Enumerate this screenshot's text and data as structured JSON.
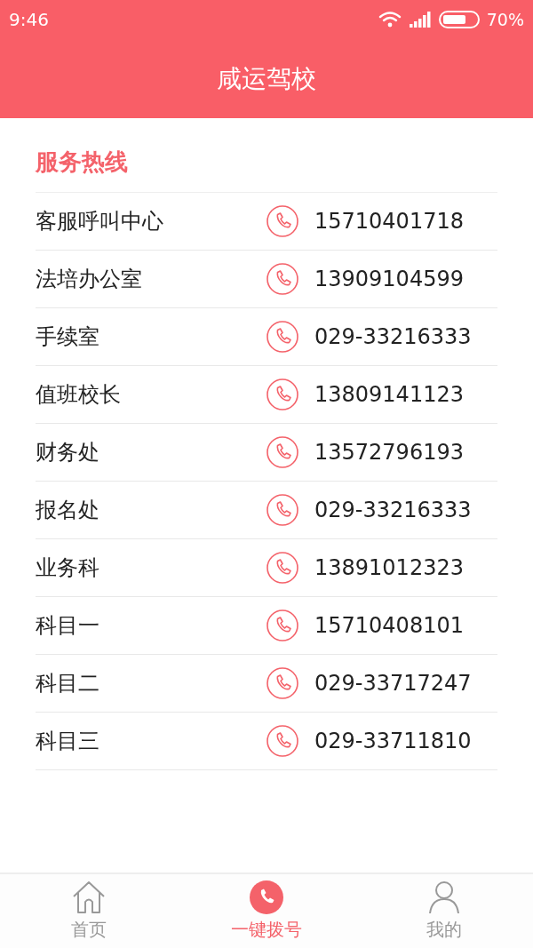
{
  "status_bar": {
    "time": "9:46",
    "battery_text": "70%"
  },
  "header": {
    "title": "咸运驾校"
  },
  "section": {
    "title": "服务热线"
  },
  "contacts": [
    {
      "name": "客服呼叫中心",
      "phone": "15710401718"
    },
    {
      "name": "法培办公室",
      "phone": "13909104599"
    },
    {
      "name": "手续室",
      "phone": "029-33216333"
    },
    {
      "name": "值班校长",
      "phone": "13809141123"
    },
    {
      "name": "财务处",
      "phone": "13572796193"
    },
    {
      "name": "报名处",
      "phone": "029-33216333"
    },
    {
      "name": "业务科",
      "phone": "13891012323"
    },
    {
      "name": "科目一",
      "phone": "15710408101"
    },
    {
      "name": "科目二",
      "phone": "029-33717247"
    },
    {
      "name": "科目三",
      "phone": "029-33711810"
    }
  ],
  "tabs": [
    {
      "label": "首页",
      "kind": "home",
      "selected": false
    },
    {
      "label": "一键拨号",
      "kind": "dial",
      "selected": true
    },
    {
      "label": "我的",
      "kind": "user",
      "selected": false
    }
  ]
}
